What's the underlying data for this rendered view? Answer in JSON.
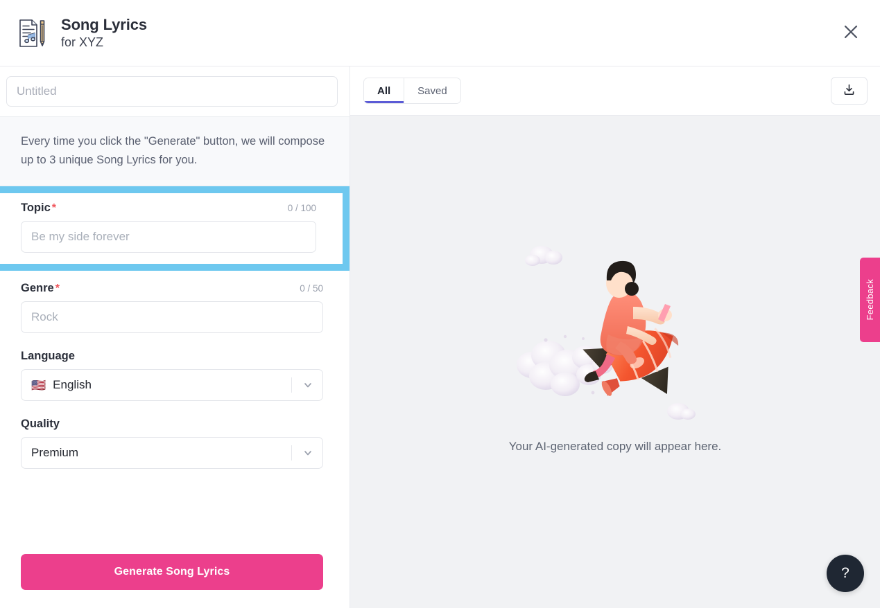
{
  "header": {
    "icon": "song-lyrics-document-icon",
    "title": "Song Lyrics",
    "subtitle": "for XYZ",
    "close_icon": "close-icon"
  },
  "left_panel": {
    "title_input": {
      "value": "",
      "placeholder": "Untitled"
    },
    "description": "Every time you click the \"Generate\" button, we will compose up to 3 unique Song Lyrics for you.",
    "fields": [
      {
        "label": "Topic",
        "required": true,
        "required_marker": "*",
        "counter": "0 / 100",
        "value": "",
        "placeholder": "Be my side forever",
        "type": "text",
        "highlighted": true
      },
      {
        "label": "Genre",
        "required": true,
        "required_marker": "*",
        "counter": "0 / 50",
        "value": "",
        "placeholder": "Rock",
        "type": "text",
        "highlighted": false
      },
      {
        "label": "Language",
        "required": false,
        "counter": "",
        "value": "English",
        "flag": "🇺🇸",
        "type": "select",
        "highlighted": false
      },
      {
        "label": "Quality",
        "required": false,
        "counter": "",
        "value": "Premium",
        "type": "select",
        "highlighted": false
      }
    ],
    "generate_button": "Generate Song Lyrics"
  },
  "right_panel": {
    "tabs": [
      {
        "label": "All",
        "active": true
      },
      {
        "label": "Saved",
        "active": false
      }
    ],
    "download_icon": "download-icon",
    "empty_state": {
      "illustration": "person-riding-rocket-illustration",
      "text": "Your AI-generated copy will appear here."
    }
  },
  "feedback_tab": {
    "label": "Feedback"
  },
  "help_button": {
    "label": "?"
  },
  "colors": {
    "accent_pink": "#ec3f8c",
    "highlight_blue": "#6ec8ef",
    "tab_underline": "#5b5bd6",
    "required_red": "#f0545a",
    "help_dark": "#1f2733",
    "panel_bg": "#f1f2f4"
  }
}
